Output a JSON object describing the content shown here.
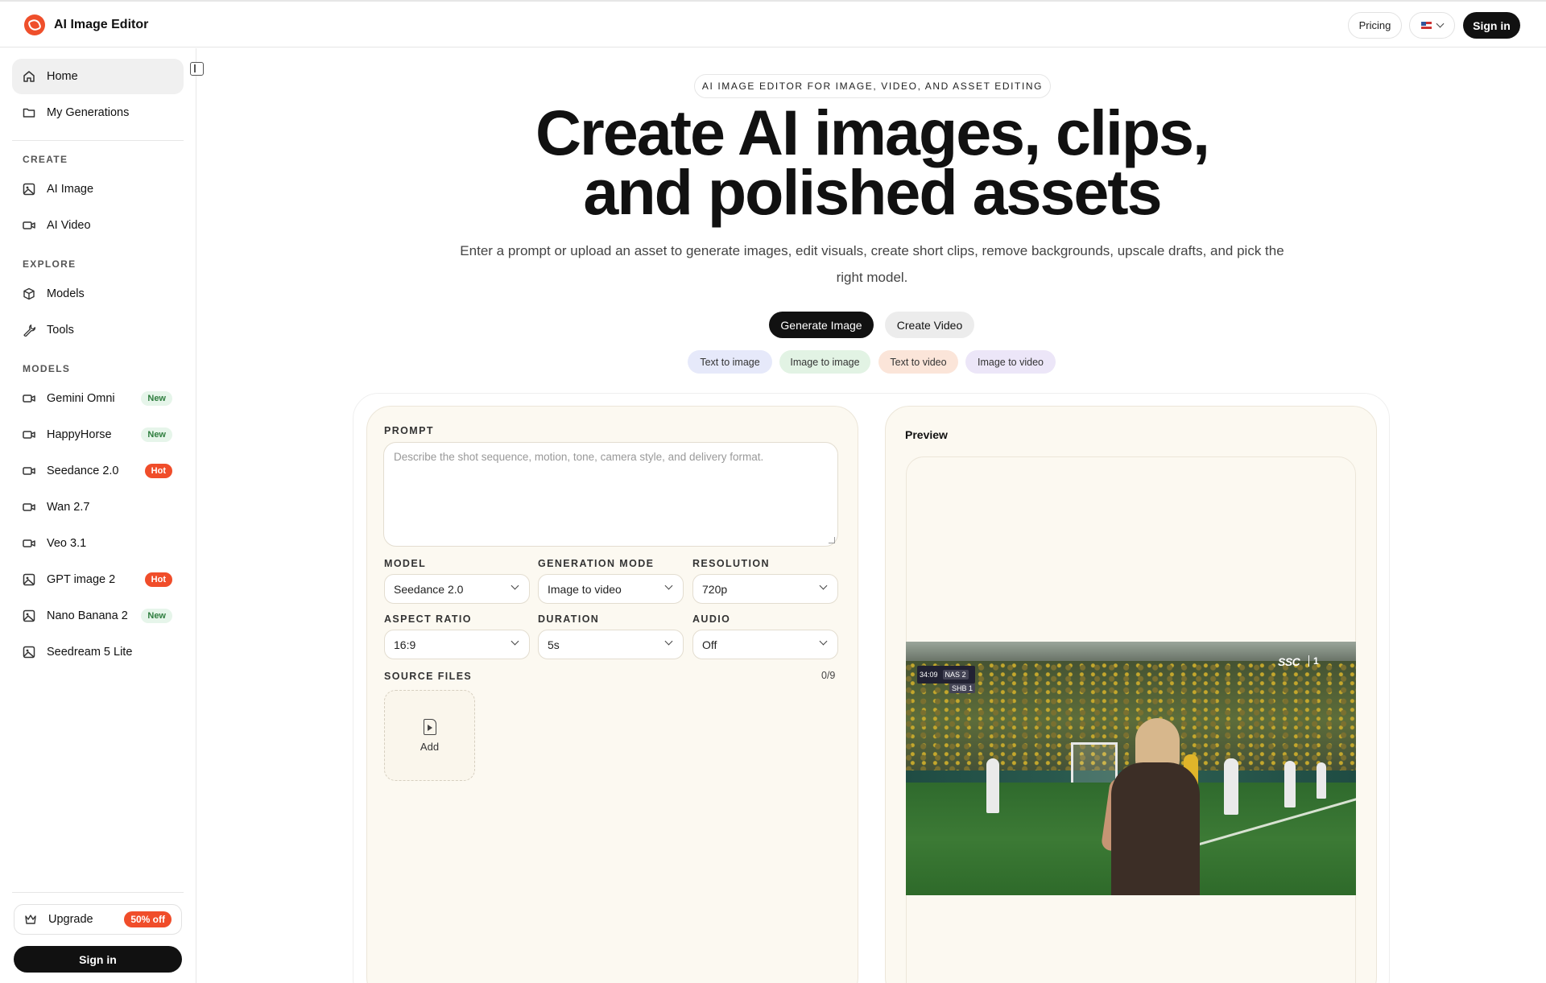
{
  "header": {
    "app_title": "AI Image Editor",
    "pricing_label": "Pricing",
    "language_flag": "🇺🇸",
    "signin_label": "Sign in"
  },
  "sidebar": {
    "top_items": [
      {
        "label": "Home",
        "icon": "home-icon",
        "active": true
      },
      {
        "label": "My Generations",
        "icon": "folder-icon"
      }
    ],
    "sections": [
      {
        "title": "CREATE",
        "items": [
          {
            "label": "AI Image",
            "icon": "image-icon"
          },
          {
            "label": "AI Video",
            "icon": "video-icon"
          }
        ]
      },
      {
        "title": "EXPLORE",
        "items": [
          {
            "label": "Models",
            "icon": "cube-icon"
          },
          {
            "label": "Tools",
            "icon": "wrench-icon"
          }
        ]
      },
      {
        "title": "MODELS",
        "items": [
          {
            "label": "Gemini Omni",
            "icon": "video-icon",
            "badge": "New"
          },
          {
            "label": "HappyHorse",
            "icon": "video-icon",
            "badge": "New"
          },
          {
            "label": "Seedance 2.0",
            "icon": "video-icon",
            "badge": "Hot"
          },
          {
            "label": "Wan 2.7",
            "icon": "video-icon"
          },
          {
            "label": "Veo 3.1",
            "icon": "video-icon"
          },
          {
            "label": "GPT image 2",
            "icon": "image-icon",
            "badge": "Hot"
          },
          {
            "label": "Nano Banana 2",
            "icon": "image-icon",
            "badge": "New"
          },
          {
            "label": "Seedream 5 Lite",
            "icon": "image-icon"
          }
        ]
      }
    ],
    "upgrade_label": "Upgrade",
    "upgrade_badge": "50% off",
    "signin_label": "Sign in"
  },
  "hero": {
    "eyebrow": "AI IMAGE EDITOR FOR IMAGE, VIDEO, AND ASSET EDITING",
    "title_line1": "Create AI images, clips,",
    "title_line2": "and polished assets",
    "subtitle": "Enter a prompt or upload an asset to generate images, edit visuals, create short clips, remove backgrounds, upscale drafts, and pick the right model.",
    "primary_button": "Generate Image",
    "secondary_button": "Create Video",
    "chips": [
      {
        "label": "Text to image",
        "color": "#e6e9fa"
      },
      {
        "label": "Image to image",
        "color": "#e2f3e4"
      },
      {
        "label": "Text to video",
        "color": "#fbe5d9"
      },
      {
        "label": "Image to video",
        "color": "#ece6f8"
      }
    ]
  },
  "form": {
    "prompt_label": "PROMPT",
    "prompt_placeholder": "Describe the shot sequence, motion, tone, camera style, and delivery format.",
    "model_label": "MODEL",
    "model_value": "Seedance 2.0",
    "mode_label": "GENERATION MODE",
    "mode_value": "Image to video",
    "resolution_label": "RESOLUTION",
    "resolution_value": "720p",
    "aspect_label": "ASPECT RATIO",
    "aspect_value": "16:9",
    "duration_label": "DURATION",
    "duration_value": "5s",
    "audio_label": "AUDIO",
    "audio_value": "Off",
    "source_label": "SOURCE FILES",
    "source_count": "0/9",
    "add_label": "Add"
  },
  "preview": {
    "title": "Preview",
    "scoreboard_time": "34:09",
    "team1": "NAS",
    "team1_score": "2",
    "team2": "SHB",
    "team2_score": "1",
    "broadcaster": "SSC",
    "channel_number": "1"
  },
  "colors": {
    "accent": "#f04d2a",
    "card_bg": "#fcf9f1",
    "dark": "#111111"
  }
}
